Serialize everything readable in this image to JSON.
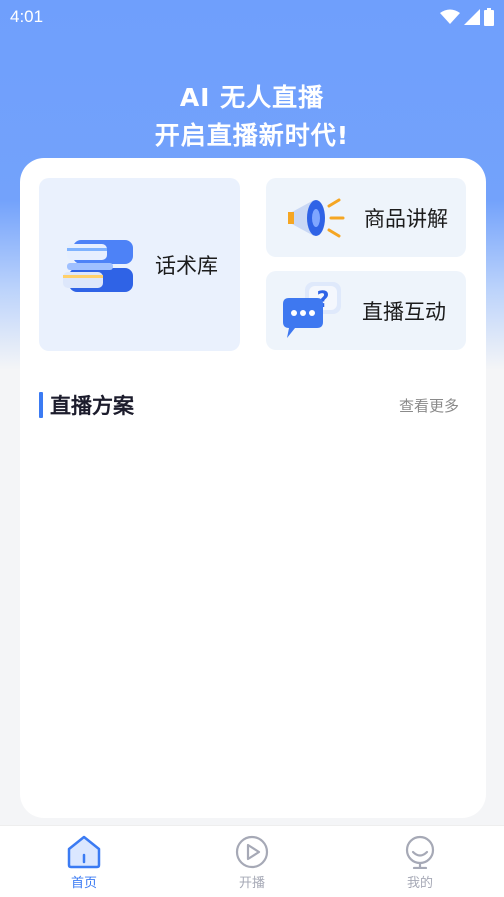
{
  "status_bar": {
    "time": "4:01",
    "icons": [
      "wifi-icon",
      "signal-icon",
      "battery-icon"
    ]
  },
  "hero": {
    "line1": "AI 无人直播",
    "line2": "开启直播新时代!"
  },
  "tiles": {
    "script_library": {
      "label": "话术库",
      "icon": "books-icon"
    },
    "product_explain": {
      "label": "商品讲解",
      "icon": "megaphone-icon"
    },
    "live_interact": {
      "label": "直播互动",
      "icon": "chat-question-icon"
    }
  },
  "section": {
    "title": "直播方案",
    "more": "查看更多"
  },
  "tabbar": {
    "items": [
      {
        "label": "首页",
        "icon": "home-icon",
        "active": true
      },
      {
        "label": "开播",
        "icon": "play-icon",
        "active": false
      },
      {
        "label": "我的",
        "icon": "profile-icon",
        "active": false
      }
    ]
  },
  "colors": {
    "accent": "#3b7bf3",
    "header_blue": "#6f9ffc",
    "tile_bg": "#eaf1fd"
  }
}
